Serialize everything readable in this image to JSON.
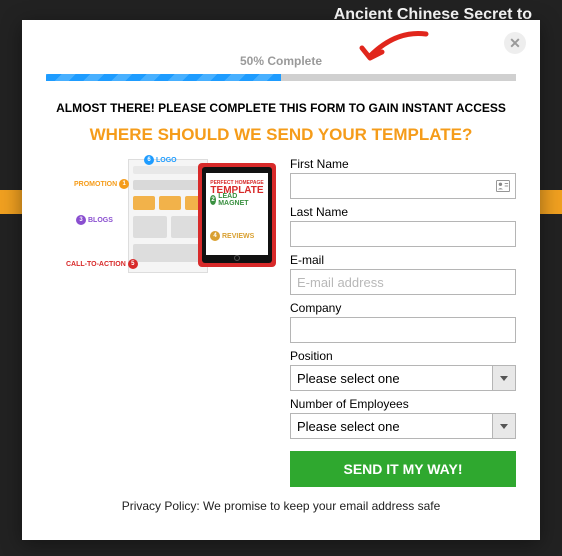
{
  "background": {
    "headline_fragment": "Ancient Chinese Secret to"
  },
  "modal": {
    "close_glyph": "✕",
    "progress": {
      "label": "50% Complete",
      "percent": 50
    },
    "line1": "ALMOST THERE! PLEASE COMPLETE THIS FORM TO GAIN INSTANT ACCESS",
    "line2": "WHERE SHOULD WE SEND YOUR TEMPLATE?",
    "illustration": {
      "badges": {
        "logo": "LOGO",
        "promotion": "PROMOTION",
        "lead_magnet": "LEAD MAGNET",
        "blogs": "BLOGS",
        "reviews": "REVIEWS",
        "cta": "CALL-TO-ACTION"
      },
      "tablet": {
        "line1": "PERFECT HOMEPAGE",
        "line2": "TEMPLATE"
      }
    },
    "form": {
      "first_name": {
        "label": "First Name",
        "value": ""
      },
      "last_name": {
        "label": "Last Name",
        "value": ""
      },
      "email": {
        "label": "E-mail",
        "placeholder": "E-mail address",
        "value": ""
      },
      "company": {
        "label": "Company",
        "value": ""
      },
      "position": {
        "label": "Position",
        "selected": "Please select one"
      },
      "employees": {
        "label": "Number of Employees",
        "selected": "Please select one"
      },
      "submit_label": "SEND IT MY WAY!"
    },
    "privacy": "Privacy Policy: We promise to keep your email address safe"
  }
}
